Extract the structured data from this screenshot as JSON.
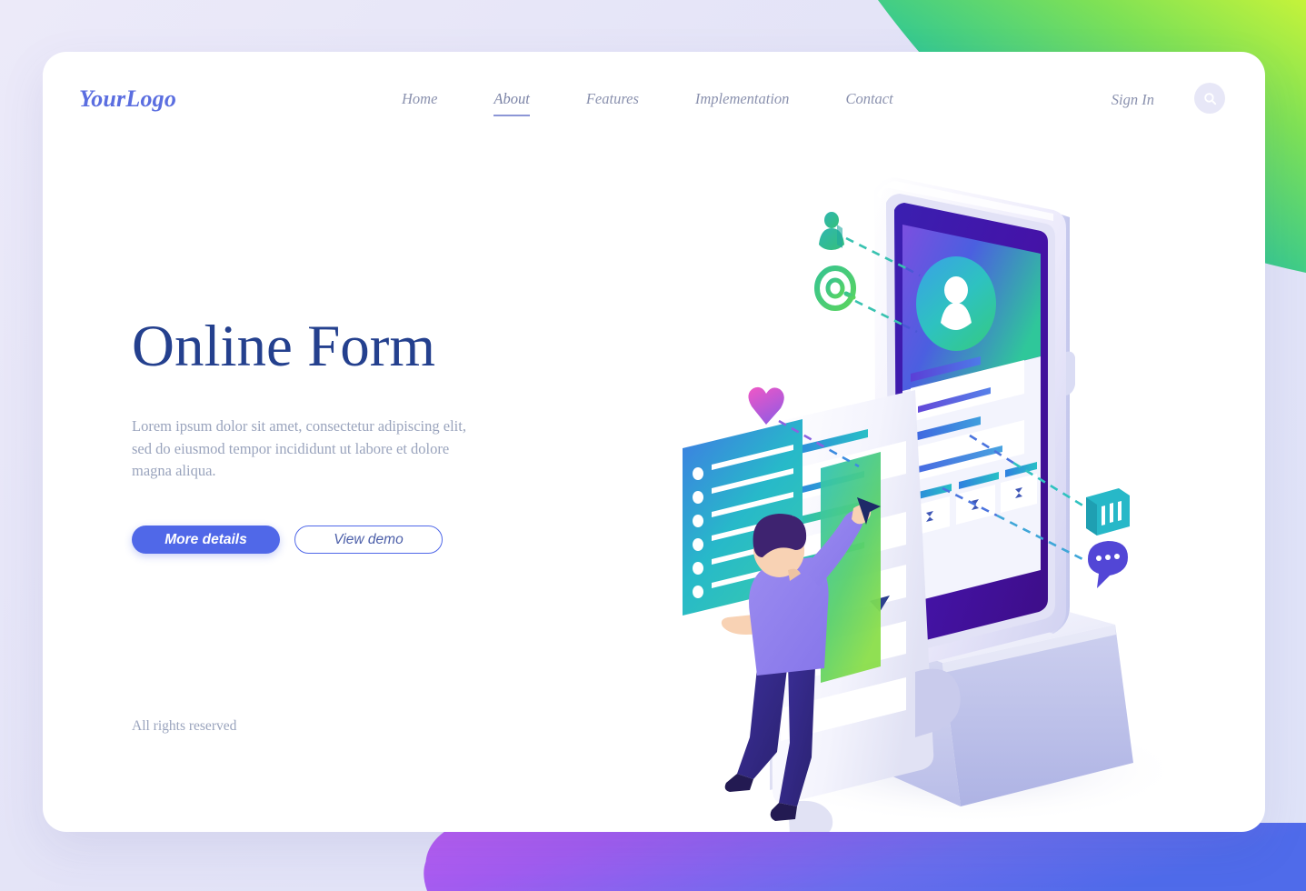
{
  "page": {
    "background_color": "#e6e6fa",
    "card_color": "#ffffff",
    "accent_color": "#5068e8",
    "title_color": "#24408e"
  },
  "header": {
    "logo": "YourLogo",
    "nav": [
      {
        "label": "Home",
        "active": false
      },
      {
        "label": "About",
        "active": true
      },
      {
        "label": "Features",
        "active": false
      },
      {
        "label": "Implementation",
        "active": false
      },
      {
        "label": "Contact",
        "active": false
      }
    ],
    "sign_in_label": "Sign In",
    "search_icon": "search-icon"
  },
  "hero": {
    "title": "Online Form",
    "subtitle": "Lorem ipsum dolor sit amet, consectetur adipiscing elit, sed do eiusmod tempor incididunt ut labore et dolore magna aliqua.",
    "primary_button": "More details",
    "secondary_button": "View demo"
  },
  "footer": {
    "rights": "All rights reserved"
  },
  "illustration": {
    "name": "isometric-online-form-illustration",
    "elements": [
      "smartphone-with-form",
      "form-document-scroll",
      "checklist-panel",
      "person-character",
      "pedestal-base"
    ],
    "floating_icons": [
      {
        "name": "person-icon",
        "color": "#2bb6a8"
      },
      {
        "name": "at-email-icon",
        "color": "#45c97e"
      },
      {
        "name": "heart-icon",
        "color": "#e060c8"
      },
      {
        "name": "calendar-icon",
        "color": "#24b6c4"
      },
      {
        "name": "chat-bubble-icon",
        "color": "#5b4bd6"
      }
    ],
    "decor": {
      "top_right_gradient": [
        "#00b8c4",
        "#52d07f",
        "#b6ef3a"
      ],
      "bottom_gradient": [
        "#b65cf0",
        "#5b70ec"
      ]
    }
  }
}
